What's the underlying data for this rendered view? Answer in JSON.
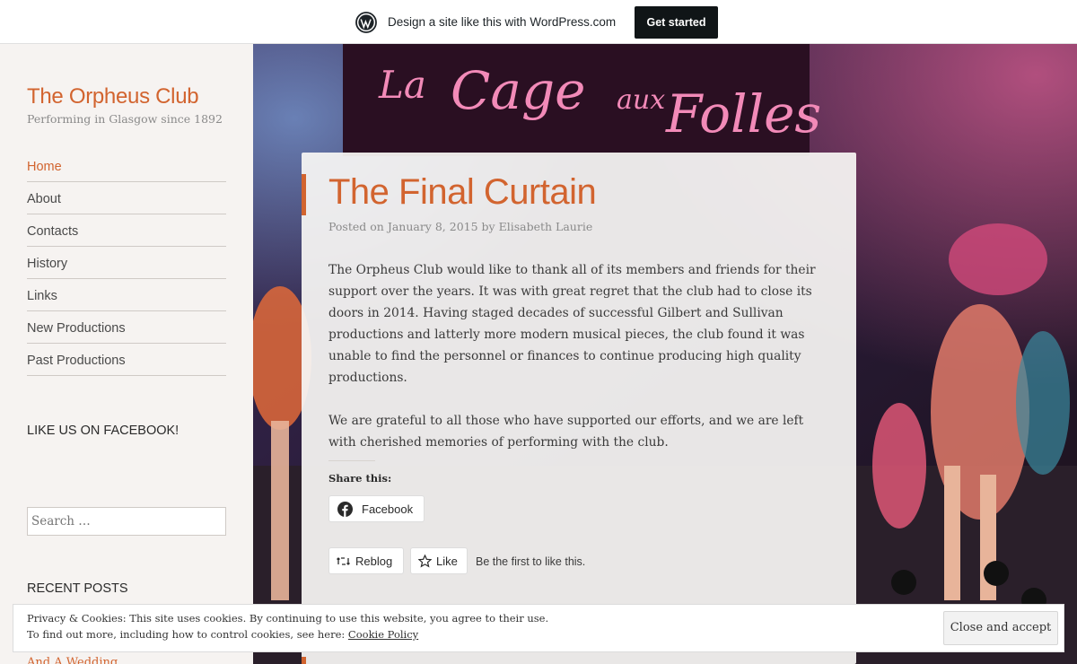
{
  "wpbar": {
    "logo_icon": "wordpress-logo-icon",
    "text": "Design a site like this with WordPress.com",
    "cta": "Get started"
  },
  "banner_image": {
    "sign_text_line1": "La",
    "sign_text_line2": "Cage",
    "sign_text_line3": "aux",
    "sign_text_line4": "Folles"
  },
  "site": {
    "title": "The Orpheus Club",
    "description": "Performing in Glasgow since 1892"
  },
  "menu": [
    {
      "label": "Home",
      "active": true
    },
    {
      "label": "About"
    },
    {
      "label": "Contacts"
    },
    {
      "label": "History"
    },
    {
      "label": "Links"
    },
    {
      "label": "New Productions"
    },
    {
      "label": "Past Productions"
    }
  ],
  "widgets": {
    "facebook_title": "LIKE US ON FACEBOOK!",
    "search_placeholder": "Search …",
    "recent_title": "RECENT POSTS",
    "recent_first": "And A Wedding"
  },
  "post": {
    "title": "The Final Curtain",
    "meta_prefix": "Posted on",
    "date": "January 8, 2015",
    "meta_by": "by",
    "author": "Elisabeth Laurie",
    "paragraphs": [
      "The Orpheus Club would like to thank all of its members and friends for their support over the years. It was with great regret that the club had to close its doors in 2014. Having staged decades of successful Gilbert and Sullivan productions and latterly more modern musical pieces, the club found it was unable to find the personnel or finances to continue producing high quality productions.",
      "We are grateful to all those who have supported our efforts, and we are left with cherished memories of performing with the club."
    ],
    "share_heading": "Share this:",
    "share_facebook": "Facebook",
    "reblog": "Reblog",
    "like": "Like",
    "first_like": "Be the first to like this."
  },
  "cookie": {
    "line1": "Privacy & Cookies: This site uses cookies. By continuing to use this website, you agree to their use.",
    "line2_prefix": "To find out more, including how to control cookies, see here:",
    "policy_link": "Cookie Policy",
    "close": "Close and accept"
  },
  "colors": {
    "accent": "#d2642f",
    "sidebar_bg": "#f6f3f1",
    "sign_pink": "#f28ab8"
  }
}
